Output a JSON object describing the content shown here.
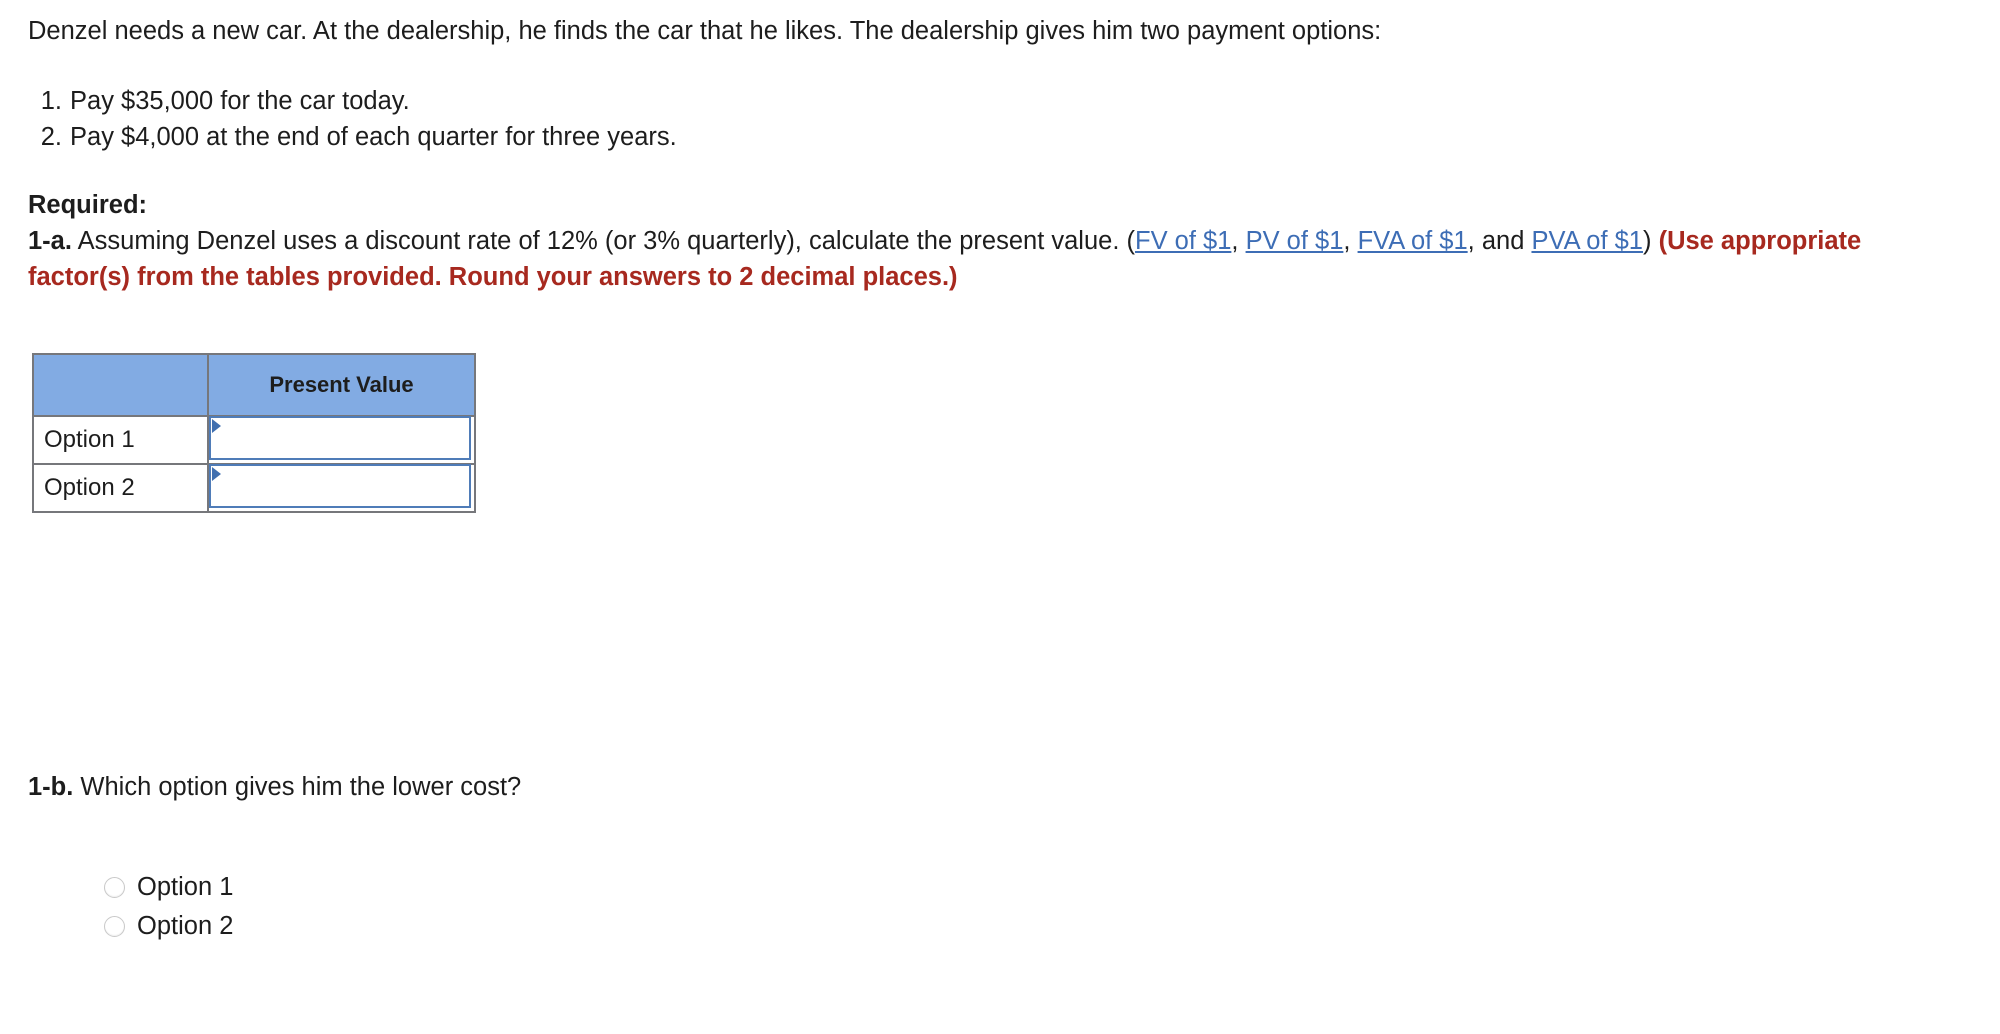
{
  "question": {
    "intro": "Denzel needs a new car. At the dealership, he finds the car that he likes. The dealership gives him two payment options:",
    "options": [
      {
        "num": "1.",
        "text": "Pay $35,000 for the car today."
      },
      {
        "num": "2.",
        "text": "Pay $4,000 at the end of each quarter for three years."
      }
    ],
    "required_heading": "Required:",
    "part_a": {
      "label": "1-a.",
      "text_before_links": " Assuming Denzel uses a discount rate of 12% (or 3% quarterly), calculate the present value. (",
      "links": [
        {
          "text": "FV of $1",
          "separator": ", "
        },
        {
          "text": "PV of $1",
          "separator": ", "
        },
        {
          "text": "FVA of $1",
          "separator": ", and "
        },
        {
          "text": "PVA of $1",
          "separator": ""
        }
      ],
      "text_after_links": ") ",
      "red_note": "(Use appropriate factor(s) from the tables provided. Round your answers to 2 decimal places.)"
    },
    "part_b": {
      "label": "1-b.",
      "text": " Which option gives him the lower cost?",
      "choices": [
        {
          "label": "Option 1",
          "selected": false
        },
        {
          "label": "Option 2",
          "selected": false
        }
      ]
    }
  },
  "answer_table": {
    "headers": [
      "",
      "Present Value"
    ],
    "rows": [
      {
        "label": "Option 1",
        "value": "",
        "placeholder": ""
      },
      {
        "label": "Option 2",
        "value": "",
        "placeholder": ""
      }
    ]
  },
  "colors": {
    "header_blue": "#82abe3",
    "link_blue": "#3d6db5",
    "note_red": "#a7291f",
    "table_border": "#76777b",
    "input_border": "#4f7cb8",
    "marker_blue": "#3f6fb0"
  }
}
